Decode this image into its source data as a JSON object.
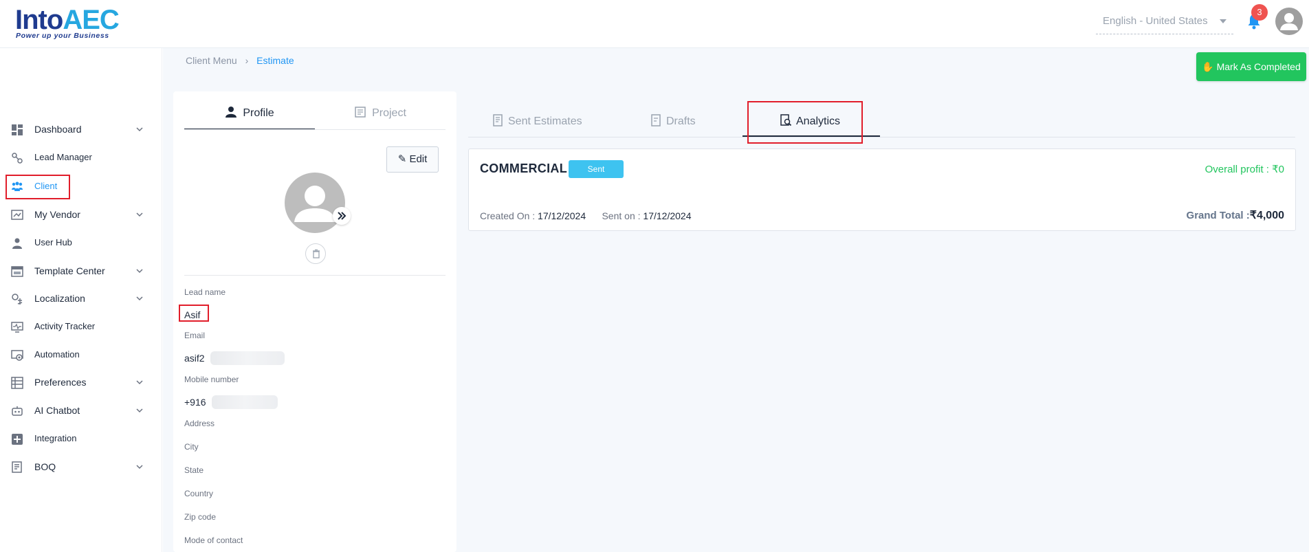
{
  "brand": {
    "name_part1": "Into",
    "name_part2": "AEC",
    "tagline": "Power up your Business"
  },
  "header": {
    "language": "English - United States",
    "notification_count": "3"
  },
  "sidebar": {
    "items": [
      {
        "label": "Dashboard",
        "icon": "dashboard-icon",
        "expandable": true
      },
      {
        "label": "Lead Manager",
        "icon": "lead-manager-icon",
        "expandable": false
      },
      {
        "label": "Client",
        "icon": "client-icon",
        "expandable": false,
        "active": true
      },
      {
        "label": "My Vendor",
        "icon": "vendor-icon",
        "expandable": true
      },
      {
        "label": "User Hub",
        "icon": "user-icon",
        "expandable": false
      },
      {
        "label": "Template Center",
        "icon": "template-icon",
        "expandable": true
      },
      {
        "label": "Localization",
        "icon": "localization-icon",
        "expandable": true
      },
      {
        "label": "Activity Tracker",
        "icon": "activity-icon",
        "expandable": false
      },
      {
        "label": "Automation",
        "icon": "automation-icon",
        "expandable": false
      },
      {
        "label": "Preferences",
        "icon": "preferences-icon",
        "expandable": true
      },
      {
        "label": "AI Chatbot",
        "icon": "chatbot-icon",
        "expandable": true
      },
      {
        "label": "Integration",
        "icon": "integration-icon",
        "expandable": false
      },
      {
        "label": "BOQ",
        "icon": "boq-icon",
        "expandable": true
      }
    ]
  },
  "breadcrumb": {
    "parent": "Client Menu",
    "current": "Estimate"
  },
  "actions": {
    "mark_completed": "Mark As Completed"
  },
  "profile_tabs": {
    "profile": "Profile",
    "project": "Project"
  },
  "profile": {
    "edit_label": "Edit",
    "fields": {
      "lead_name_label": "Lead name",
      "lead_name": "Asif",
      "email_label": "Email",
      "email": "asif2",
      "mobile_label": "Mobile number",
      "mobile": "+916",
      "address_label": "Address",
      "city_label": "City",
      "state_label": "State",
      "country_label": "Country",
      "zip_label": "Zip code",
      "mode_label": "Mode of contact"
    }
  },
  "estimate_tabs": {
    "sent": "Sent Estimates",
    "drafts": "Drafts",
    "analytics": "Analytics",
    "active": "Analytics"
  },
  "estimate_card": {
    "title": "COMMERCIAL",
    "status": "Sent",
    "overall_profit": "Overall profit : ₹0",
    "created_label": "Created On :",
    "created_date": "17/12/2024",
    "sent_label": "Sent on :",
    "sent_date": "17/12/2024",
    "grand_total_label": "Grand Total :",
    "grand_total_value": "₹4,000"
  },
  "colors": {
    "accent": "#2196f3",
    "success": "#22c55e",
    "status_sent": "#3ec3f0",
    "highlight": "#e11d2a",
    "badge": "#ef5350"
  }
}
